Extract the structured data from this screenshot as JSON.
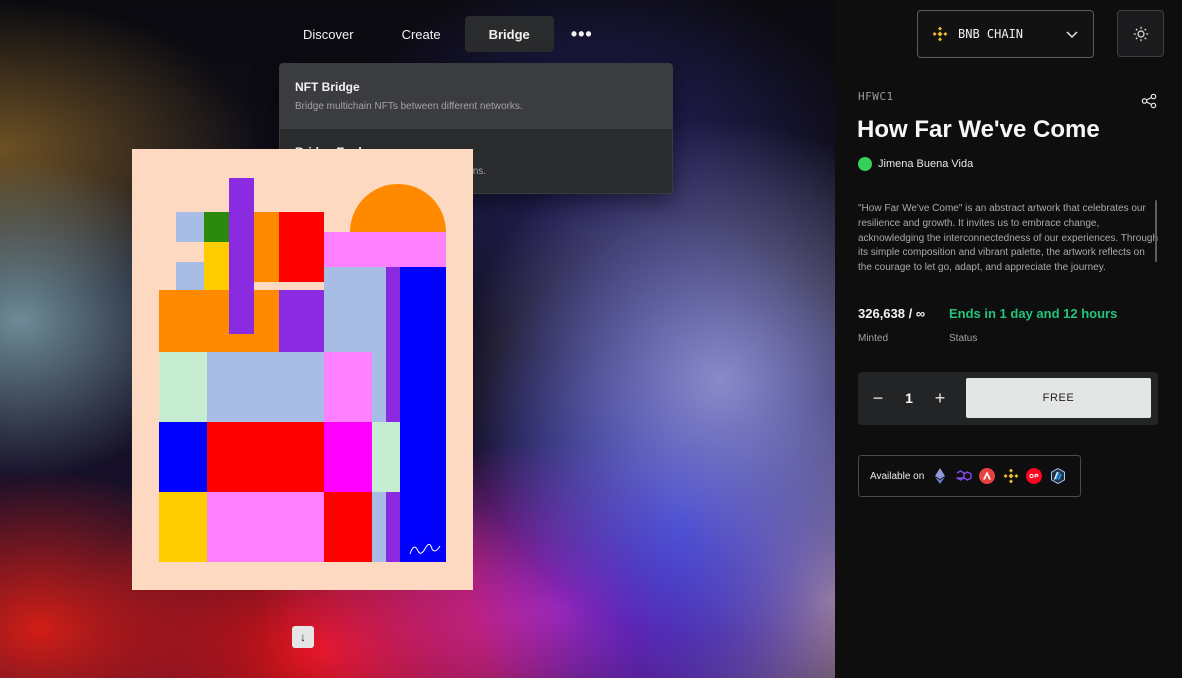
{
  "nav": {
    "items": [
      {
        "label": "Discover"
      },
      {
        "label": "Create"
      },
      {
        "label": "Bridge"
      }
    ],
    "more_label": "•••"
  },
  "bridge_menu": {
    "items": [
      {
        "title": "NFT Bridge",
        "description": "Bridge multichain NFTs between different networks."
      },
      {
        "title": "Bridge Explorer",
        "description": "View the status of your bridge transactions."
      }
    ]
  },
  "artwork": {
    "signature": "Jimena"
  },
  "scroll_down_glyph": "↓",
  "chain": {
    "label": "BNB CHAIN",
    "icon": "bnb-icon",
    "color": "#f3ba2f"
  },
  "nft": {
    "ticker": "HFWC1",
    "title": "How Far We've Come",
    "author": "Jimena Buena Vida",
    "description": "\"How Far We've Come\" is an abstract artwork that celebrates our resilience and growth. It invites us to embrace change, acknowledging the interconnectedness of our experiences. Through its simple composition and vibrant palette, the artwork reflects on the courage to let go, adapt, and appreciate the journey."
  },
  "stats": {
    "minted_value": "326,638 / ∞",
    "minted_label": "Minted",
    "status_value": "Ends in 1 day and 12 hours",
    "status_label": "Status",
    "status_color": "#22c37a"
  },
  "mint": {
    "minus": "−",
    "quantity": "1",
    "plus": "+",
    "button_label": "FREE"
  },
  "availability": {
    "label": "Available on",
    "networks": [
      "ethereum-icon",
      "polygon-icon",
      "avalanche-icon",
      "bnb-icon",
      "optimism-icon",
      "arbitrum-icon"
    ]
  }
}
